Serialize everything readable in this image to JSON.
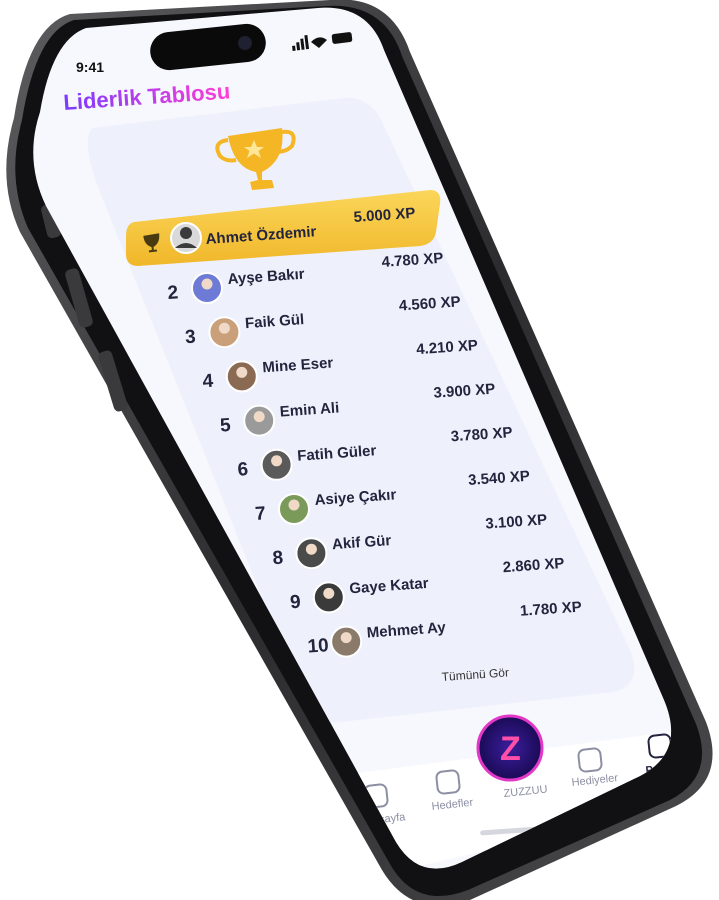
{
  "status_bar": {
    "time": "9:41"
  },
  "header": {
    "title": "Liderlik Tablosu"
  },
  "leaderboard": {
    "leader": {
      "name": "Ahmet Özdemir",
      "xp": "5.000 XP"
    },
    "rows": [
      {
        "rank": "2",
        "name": "Ayşe Bakır",
        "xp": "4.780 XP"
      },
      {
        "rank": "3",
        "name": "Faik Gül",
        "xp": "4.560 XP"
      },
      {
        "rank": "4",
        "name": "Mine Eser",
        "xp": "4.210 XP"
      },
      {
        "rank": "5",
        "name": "Emin Ali",
        "xp": "3.900 XP"
      },
      {
        "rank": "6",
        "name": "Fatih Güler",
        "xp": "3.780 XP"
      },
      {
        "rank": "7",
        "name": "Asiye Çakır",
        "xp": "3.540 XP"
      },
      {
        "rank": "8",
        "name": "Akif Gür",
        "xp": "3.100 XP"
      },
      {
        "rank": "9",
        "name": "Gaye Katar",
        "xp": "2.860 XP"
      },
      {
        "rank": "10",
        "name": "Mehmet Ay",
        "xp": "1.780 XP"
      }
    ],
    "see_all": "Tümünü Gör"
  },
  "bottom_nav": {
    "items": [
      {
        "label": "Anasayfa",
        "icon": "home-icon"
      },
      {
        "label": "Hedefler",
        "icon": "list-icon"
      },
      {
        "label": "ZUZZUU",
        "icon": "zuzzuu-logo"
      },
      {
        "label": "Hediyeler",
        "icon": "gift-icon"
      },
      {
        "label": "Profilim",
        "icon": "profile-icon"
      }
    ]
  },
  "colors": {
    "accent_gradient_start": "#7a3cff",
    "accent_gradient_end": "#ff3fd6",
    "leader_gold": "#f8c63a",
    "text_dark": "#23243d",
    "nav_inactive": "#8c8fa3"
  }
}
